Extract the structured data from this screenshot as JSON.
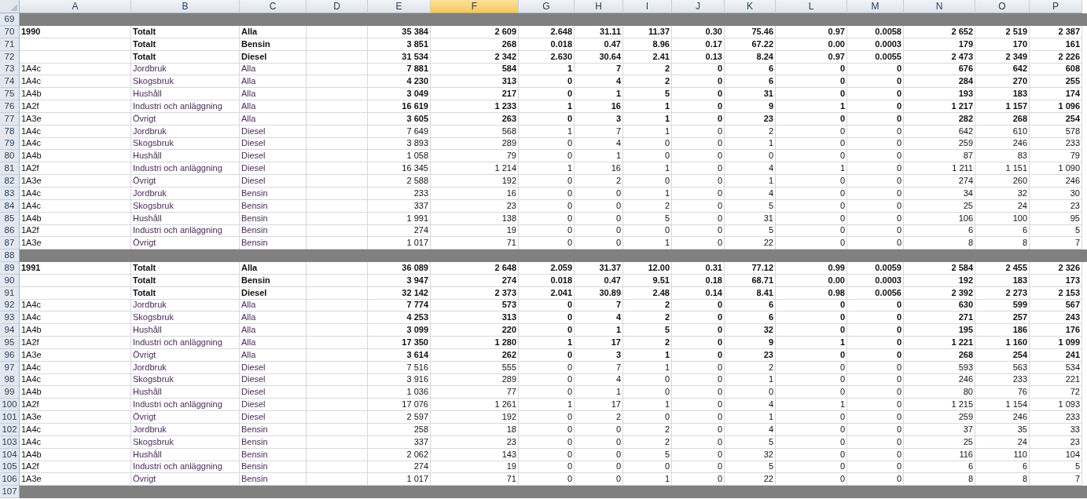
{
  "columns": [
    {
      "label": "A",
      "selected": false
    },
    {
      "label": "B",
      "selected": false
    },
    {
      "label": "C",
      "selected": false
    },
    {
      "label": "D",
      "selected": false
    },
    {
      "label": "E",
      "selected": false
    },
    {
      "label": "F",
      "selected": true
    },
    {
      "label": "G",
      "selected": false
    },
    {
      "label": "H",
      "selected": false
    },
    {
      "label": "I",
      "selected": false
    },
    {
      "label": "J",
      "selected": false
    },
    {
      "label": "K",
      "selected": false
    },
    {
      "label": "L",
      "selected": false
    },
    {
      "label": "M",
      "selected": false
    },
    {
      "label": "N",
      "selected": false
    },
    {
      "label": "O",
      "selected": false
    },
    {
      "label": "P",
      "selected": false
    }
  ],
  "rows": [
    {
      "row": "69",
      "kind": "separator"
    },
    {
      "row": "70",
      "kind": "data",
      "code": "1990",
      "sector": "Totalt",
      "fuel": "Alla",
      "bold_labels": true,
      "bold_values": true,
      "values": [
        "35 384",
        "2 609",
        "2.648",
        "31.11",
        "11.37",
        "0.30",
        "75.46",
        "0.97",
        "0.0058",
        "2 652",
        "2 519",
        "2 387"
      ]
    },
    {
      "row": "71",
      "kind": "data",
      "sector": "Totalt",
      "fuel": "Bensin",
      "bold_labels": true,
      "bold_values": true,
      "values": [
        "3 851",
        "268",
        "0.018",
        "0.47",
        "8.96",
        "0.17",
        "67.22",
        "0.00",
        "0.0003",
        "179",
        "170",
        "161"
      ]
    },
    {
      "row": "72",
      "kind": "data",
      "sector": "Totalt",
      "fuel": "Diesel",
      "bold_labels": true,
      "bold_values": true,
      "values": [
        "31 534",
        "2 342",
        "2.630",
        "30.64",
        "2.41",
        "0.13",
        "8.24",
        "0.97",
        "0.0055",
        "2 473",
        "2 349",
        "2 226"
      ]
    },
    {
      "row": "73",
      "kind": "data",
      "code": "1A4c",
      "sector": "Jordbruk",
      "fuel": "Alla",
      "bold_labels": false,
      "bold_values": true,
      "values": [
        "7 881",
        "584",
        "1",
        "7",
        "2",
        "0",
        "6",
        "0",
        "0",
        "676",
        "642",
        "608"
      ]
    },
    {
      "row": "74",
      "kind": "data",
      "code": "1A4c",
      "sector": "Skogsbruk",
      "fuel": "Alla",
      "bold_labels": false,
      "bold_values": true,
      "values": [
        "4 230",
        "313",
        "0",
        "4",
        "2",
        "0",
        "6",
        "0",
        "0",
        "284",
        "270",
        "255"
      ]
    },
    {
      "row": "75",
      "kind": "data",
      "code": "1A4b",
      "sector": "Hushåll",
      "fuel": "Alla",
      "bold_labels": false,
      "bold_values": true,
      "values": [
        "3 049",
        "217",
        "0",
        "1",
        "5",
        "0",
        "31",
        "0",
        "0",
        "193",
        "183",
        "174"
      ]
    },
    {
      "row": "76",
      "kind": "data",
      "code": "1A2f",
      "sector": "Industri och anläggning",
      "fuel": "Alla",
      "bold_labels": false,
      "bold_values": true,
      "values": [
        "16 619",
        "1 233",
        "1",
        "16",
        "1",
        "0",
        "9",
        "1",
        "0",
        "1 217",
        "1 157",
        "1 096"
      ]
    },
    {
      "row": "77",
      "kind": "data",
      "code": "1A3e",
      "sector": "Övrigt",
      "fuel": "Alla",
      "bold_labels": false,
      "bold_values": true,
      "values": [
        "3 605",
        "263",
        "0",
        "3",
        "1",
        "0",
        "23",
        "0",
        "0",
        "282",
        "268",
        "254"
      ]
    },
    {
      "row": "78",
      "kind": "data",
      "code": "1A4c",
      "sector": "Jordbruk",
      "fuel": "Diesel",
      "bold_labels": false,
      "bold_values": false,
      "values": [
        "7 649",
        "568",
        "1",
        "7",
        "1",
        "0",
        "2",
        "0",
        "0",
        "642",
        "610",
        "578"
      ]
    },
    {
      "row": "79",
      "kind": "data",
      "code": "1A4c",
      "sector": "Skogsbruk",
      "fuel": "Diesel",
      "bold_labels": false,
      "bold_values": false,
      "values": [
        "3 893",
        "289",
        "0",
        "4",
        "0",
        "0",
        "1",
        "0",
        "0",
        "259",
        "246",
        "233"
      ]
    },
    {
      "row": "80",
      "kind": "data",
      "code": "1A4b",
      "sector": "Hushåll",
      "fuel": "Diesel",
      "bold_labels": false,
      "bold_values": false,
      "values": [
        "1 058",
        "79",
        "0",
        "1",
        "0",
        "0",
        "0",
        "0",
        "0",
        "87",
        "83",
        "79"
      ]
    },
    {
      "row": "81",
      "kind": "data",
      "code": "1A2f",
      "sector": "Industri och anläggning",
      "fuel": "Diesel",
      "bold_labels": false,
      "bold_values": false,
      "values": [
        "16 345",
        "1 214",
        "1",
        "16",
        "1",
        "0",
        "4",
        "1",
        "0",
        "1 211",
        "1 151",
        "1 090"
      ]
    },
    {
      "row": "82",
      "kind": "data",
      "code": "1A3e",
      "sector": "Övrigt",
      "fuel": "Diesel",
      "bold_labels": false,
      "bold_values": false,
      "values": [
        "2 588",
        "192",
        "0",
        "2",
        "0",
        "0",
        "1",
        "0",
        "0",
        "274",
        "260",
        "246"
      ]
    },
    {
      "row": "83",
      "kind": "data",
      "code": "1A4c",
      "sector": "Jordbruk",
      "fuel": "Bensin",
      "bold_labels": false,
      "bold_values": false,
      "values": [
        "233",
        "16",
        "0",
        "0",
        "1",
        "0",
        "4",
        "0",
        "0",
        "34",
        "32",
        "30"
      ]
    },
    {
      "row": "84",
      "kind": "data",
      "code": "1A4c",
      "sector": "Skogsbruk",
      "fuel": "Bensin",
      "bold_labels": false,
      "bold_values": false,
      "values": [
        "337",
        "23",
        "0",
        "0",
        "2",
        "0",
        "5",
        "0",
        "0",
        "25",
        "24",
        "23"
      ]
    },
    {
      "row": "85",
      "kind": "data",
      "code": "1A4b",
      "sector": "Hushåll",
      "fuel": "Bensin",
      "bold_labels": false,
      "bold_values": false,
      "values": [
        "1 991",
        "138",
        "0",
        "0",
        "5",
        "0",
        "31",
        "0",
        "0",
        "106",
        "100",
        "95"
      ]
    },
    {
      "row": "86",
      "kind": "data",
      "code": "1A2f",
      "sector": "Industri och anläggning",
      "fuel": "Bensin",
      "bold_labels": false,
      "bold_values": false,
      "values": [
        "274",
        "19",
        "0",
        "0",
        "0",
        "0",
        "5",
        "0",
        "0",
        "6",
        "6",
        "5"
      ]
    },
    {
      "row": "87",
      "kind": "data",
      "code": "1A3e",
      "sector": "Övrigt",
      "fuel": "Bensin",
      "bold_labels": false,
      "bold_values": false,
      "values": [
        "1 017",
        "71",
        "0",
        "0",
        "1",
        "0",
        "22",
        "0",
        "0",
        "8",
        "8",
        "7"
      ]
    },
    {
      "row": "88",
      "kind": "separator"
    },
    {
      "row": "89",
      "kind": "data",
      "code": "1991",
      "sector": "Totalt",
      "fuel": "Alla",
      "bold_labels": true,
      "bold_values": true,
      "values": [
        "36 089",
        "2 648",
        "2.059",
        "31.37",
        "12.00",
        "0.31",
        "77.12",
        "0.99",
        "0.0059",
        "2 584",
        "2 455",
        "2 326"
      ]
    },
    {
      "row": "90",
      "kind": "data",
      "sector": "Totalt",
      "fuel": "Bensin",
      "bold_labels": true,
      "bold_values": true,
      "values": [
        "3 947",
        "274",
        "0.018",
        "0.47",
        "9.51",
        "0.18",
        "68.71",
        "0.00",
        "0.0003",
        "192",
        "183",
        "173"
      ]
    },
    {
      "row": "91",
      "kind": "data",
      "sector": "Totalt",
      "fuel": "Diesel",
      "bold_labels": true,
      "bold_values": true,
      "values": [
        "32 142",
        "2 373",
        "2.041",
        "30.89",
        "2.48",
        "0.14",
        "8.41",
        "0.98",
        "0.0056",
        "2 392",
        "2 273",
        "2 153"
      ]
    },
    {
      "row": "92",
      "kind": "data",
      "code": "1A4c",
      "sector": "Jordbruk",
      "fuel": "Alla",
      "bold_labels": false,
      "bold_values": true,
      "values": [
        "7 774",
        "573",
        "0",
        "7",
        "2",
        "0",
        "6",
        "0",
        "0",
        "630",
        "599",
        "567"
      ]
    },
    {
      "row": "93",
      "kind": "data",
      "code": "1A4c",
      "sector": "Skogsbruk",
      "fuel": "Alla",
      "bold_labels": false,
      "bold_values": true,
      "values": [
        "4 253",
        "313",
        "0",
        "4",
        "2",
        "0",
        "6",
        "0",
        "0",
        "271",
        "257",
        "243"
      ]
    },
    {
      "row": "94",
      "kind": "data",
      "code": "1A4b",
      "sector": "Hushåll",
      "fuel": "Alla",
      "bold_labels": false,
      "bold_values": true,
      "values": [
        "3 099",
        "220",
        "0",
        "1",
        "5",
        "0",
        "32",
        "0",
        "0",
        "195",
        "186",
        "176"
      ]
    },
    {
      "row": "95",
      "kind": "data",
      "code": "1A2f",
      "sector": "Industri och anläggning",
      "fuel": "Alla",
      "bold_labels": false,
      "bold_values": true,
      "values": [
        "17 350",
        "1 280",
        "1",
        "17",
        "2",
        "0",
        "9",
        "1",
        "0",
        "1 221",
        "1 160",
        "1 099"
      ]
    },
    {
      "row": "96",
      "kind": "data",
      "code": "1A3e",
      "sector": "Övrigt",
      "fuel": "Alla",
      "bold_labels": false,
      "bold_values": true,
      "values": [
        "3 614",
        "262",
        "0",
        "3",
        "1",
        "0",
        "23",
        "0",
        "0",
        "268",
        "254",
        "241"
      ]
    },
    {
      "row": "97",
      "kind": "data",
      "code": "1A4c",
      "sector": "Jordbruk",
      "fuel": "Diesel",
      "bold_labels": false,
      "bold_values": false,
      "values": [
        "7 516",
        "555",
        "0",
        "7",
        "1",
        "0",
        "2",
        "0",
        "0",
        "593",
        "563",
        "534"
      ]
    },
    {
      "row": "98",
      "kind": "data",
      "code": "1A4c",
      "sector": "Skogsbruk",
      "fuel": "Diesel",
      "bold_labels": false,
      "bold_values": false,
      "values": [
        "3 916",
        "289",
        "0",
        "4",
        "0",
        "0",
        "1",
        "0",
        "0",
        "246",
        "233",
        "221"
      ]
    },
    {
      "row": "99",
      "kind": "data",
      "code": "1A4b",
      "sector": "Hushåll",
      "fuel": "Diesel",
      "bold_labels": false,
      "bold_values": false,
      "values": [
        "1 036",
        "77",
        "0",
        "1",
        "0",
        "0",
        "0",
        "0",
        "0",
        "80",
        "76",
        "72"
      ]
    },
    {
      "row": "100",
      "kind": "data",
      "code": "1A2f",
      "sector": "Industri och anläggning",
      "fuel": "Diesel",
      "bold_labels": false,
      "bold_values": false,
      "values": [
        "17 076",
        "1 261",
        "1",
        "17",
        "1",
        "0",
        "4",
        "1",
        "0",
        "1 215",
        "1 154",
        "1 093"
      ]
    },
    {
      "row": "101",
      "kind": "data",
      "code": "1A3e",
      "sector": "Övrigt",
      "fuel": "Diesel",
      "bold_labels": false,
      "bold_values": false,
      "values": [
        "2 597",
        "192",
        "0",
        "2",
        "0",
        "0",
        "1",
        "0",
        "0",
        "259",
        "246",
        "233"
      ]
    },
    {
      "row": "102",
      "kind": "data",
      "code": "1A4c",
      "sector": "Jordbruk",
      "fuel": "Bensin",
      "bold_labels": false,
      "bold_values": false,
      "values": [
        "258",
        "18",
        "0",
        "0",
        "2",
        "0",
        "4",
        "0",
        "0",
        "37",
        "35",
        "33"
      ]
    },
    {
      "row": "103",
      "kind": "data",
      "code": "1A4c",
      "sector": "Skogsbruk",
      "fuel": "Bensin",
      "bold_labels": false,
      "bold_values": false,
      "values": [
        "337",
        "23",
        "0",
        "0",
        "2",
        "0",
        "5",
        "0",
        "0",
        "25",
        "24",
        "23"
      ]
    },
    {
      "row": "104",
      "kind": "data",
      "code": "1A4b",
      "sector": "Hushåll",
      "fuel": "Bensin",
      "bold_labels": false,
      "bold_values": false,
      "values": [
        "2 062",
        "143",
        "0",
        "0",
        "5",
        "0",
        "32",
        "0",
        "0",
        "116",
        "110",
        "104"
      ]
    },
    {
      "row": "105",
      "kind": "data",
      "code": "1A2f",
      "sector": "Industri och anläggning",
      "fuel": "Bensin",
      "bold_labels": false,
      "bold_values": false,
      "values": [
        "274",
        "19",
        "0",
        "0",
        "0",
        "0",
        "5",
        "0",
        "0",
        "6",
        "6",
        "5"
      ]
    },
    {
      "row": "106",
      "kind": "data",
      "code": "1A3e",
      "sector": "Övrigt",
      "fuel": "Bensin",
      "bold_labels": false,
      "bold_values": false,
      "values": [
        "1 017",
        "71",
        "0",
        "0",
        "1",
        "0",
        "22",
        "0",
        "0",
        "8",
        "8",
        "7"
      ]
    },
    {
      "row": "107",
      "kind": "separator"
    }
  ]
}
